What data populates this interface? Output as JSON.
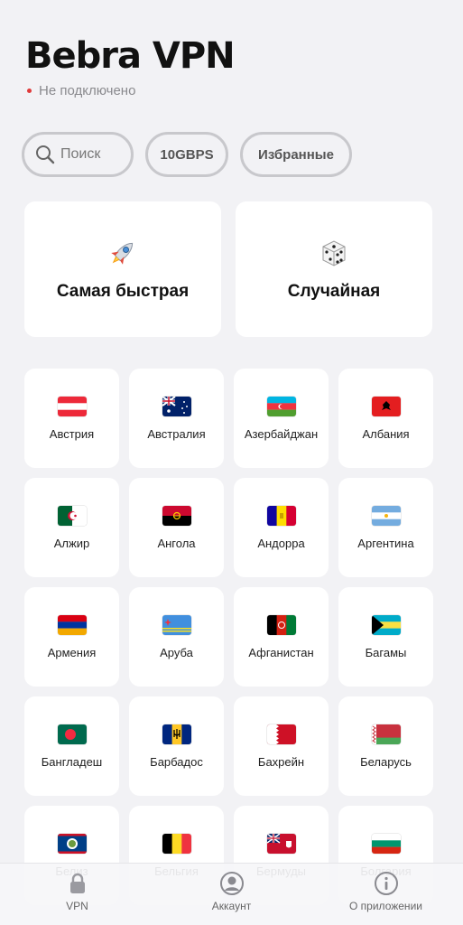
{
  "header": {
    "title": "Bebra VPN",
    "status": "Не подключено"
  },
  "filters": {
    "search_placeholder": "Поиск",
    "speed": "10GBPS",
    "favorites": "Избранные"
  },
  "quick": [
    {
      "emoji": "🚀",
      "label": "Самая быстрая"
    },
    {
      "emoji": "🎲",
      "label": "Случайная"
    }
  ],
  "countries": [
    {
      "name": "Австрия",
      "flag": "austria"
    },
    {
      "name": "Австралия",
      "flag": "australia"
    },
    {
      "name": "Азербайджан",
      "flag": "azerbaijan"
    },
    {
      "name": "Албания",
      "flag": "albania"
    },
    {
      "name": "Алжир",
      "flag": "algeria"
    },
    {
      "name": "Ангола",
      "flag": "angola"
    },
    {
      "name": "Андорра",
      "flag": "andorra"
    },
    {
      "name": "Аргентина",
      "flag": "argentina"
    },
    {
      "name": "Армения",
      "flag": "armenia"
    },
    {
      "name": "Аруба",
      "flag": "aruba"
    },
    {
      "name": "Афганистан",
      "flag": "afghanistan"
    },
    {
      "name": "Багамы",
      "flag": "bahamas"
    },
    {
      "name": "Бангладеш",
      "flag": "bangladesh"
    },
    {
      "name": "Барбадос",
      "flag": "barbados"
    },
    {
      "name": "Бахрейн",
      "flag": "bahrain"
    },
    {
      "name": "Беларусь",
      "flag": "belarus"
    },
    {
      "name": "Белиз",
      "flag": "belize"
    },
    {
      "name": "Бельгия",
      "flag": "belgium"
    },
    {
      "name": "Бермуды",
      "flag": "bermuda"
    },
    {
      "name": "Болгария",
      "flag": "bulgaria"
    }
  ],
  "tabbar": [
    {
      "label": "VPN",
      "icon": "lock-icon"
    },
    {
      "label": "Аккаунт",
      "icon": "account-icon"
    },
    {
      "label": "О приложении",
      "icon": "info-icon"
    }
  ],
  "colors": {
    "background": "#f2f2f5",
    "status_dot": "#e03a3a",
    "card": "#ffffff"
  }
}
